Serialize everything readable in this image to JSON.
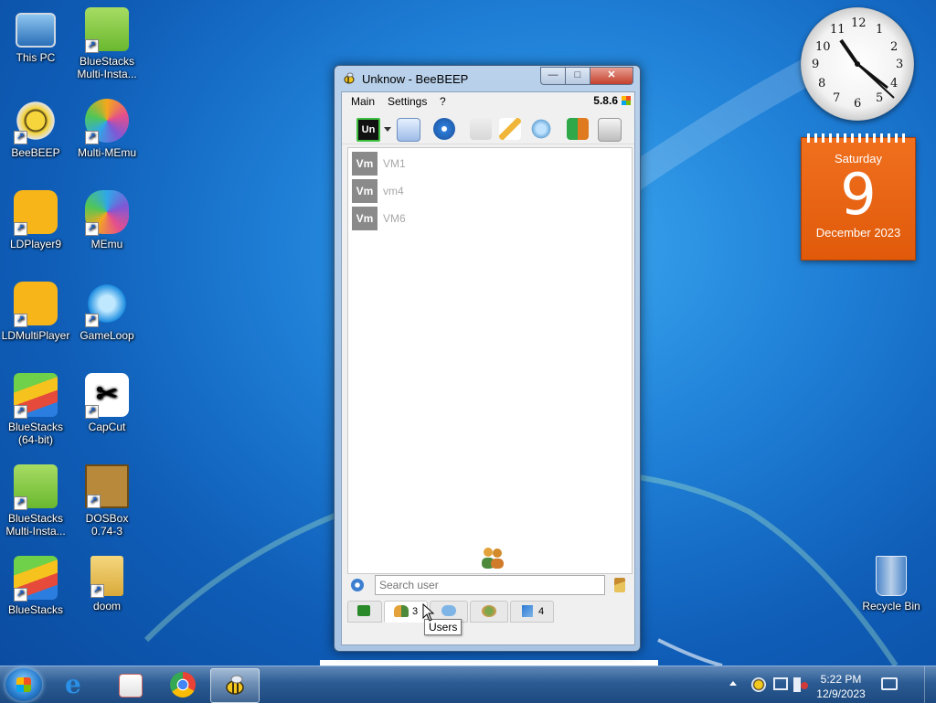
{
  "desktop": {
    "icons": [
      {
        "label": "This PC"
      },
      {
        "label": "BlueStacks\nMulti-Insta..."
      },
      {
        "label": "BeeBEEP"
      },
      {
        "label": "Multi-MEmu"
      },
      {
        "label": "LDPlayer9"
      },
      {
        "label": "MEmu"
      },
      {
        "label": "LDMultiPlayer"
      },
      {
        "label": "GameLoop"
      },
      {
        "label": "BlueStacks\n(64-bit)"
      },
      {
        "label": "CapCut"
      },
      {
        "label": "BlueStacks\nMulti-Insta..."
      },
      {
        "label": "DOSBox\n0.74-3"
      },
      {
        "label": "BlueStacks"
      },
      {
        "label": "doom"
      },
      {
        "label": "Recycle Bin"
      }
    ]
  },
  "clock_gadget": {
    "numbers": [
      "12",
      "1",
      "2",
      "3",
      "4",
      "5",
      "6",
      "7",
      "8",
      "9",
      "10",
      "11"
    ]
  },
  "calendar_gadget": {
    "weekday": "Saturday",
    "day": "9",
    "month_year": "December 2023"
  },
  "window": {
    "title": "Unknow - BeeBEEP",
    "min_glyph": "—",
    "max_glyph": "□",
    "close_glyph": "✕",
    "menu": {
      "main": "Main",
      "settings": "Settings",
      "help": "?"
    },
    "version": "5.8.6",
    "status_badge": "Un",
    "users": [
      {
        "avatar": "Vm",
        "name": "VM1"
      },
      {
        "avatar": "Vm",
        "name": "vm4"
      },
      {
        "avatar": "Vm",
        "name": "VM6"
      }
    ],
    "search_placeholder": "Search user",
    "tabs": {
      "users_count": "3",
      "groups_count": "4"
    },
    "tooltip": "Users"
  },
  "taskbar": {
    "time": "5:22 PM",
    "date": "12/9/2023"
  },
  "colors": {
    "accent": "#1f7fd6",
    "calendar": "#e8651a",
    "taskbar": "#2b5b92"
  }
}
